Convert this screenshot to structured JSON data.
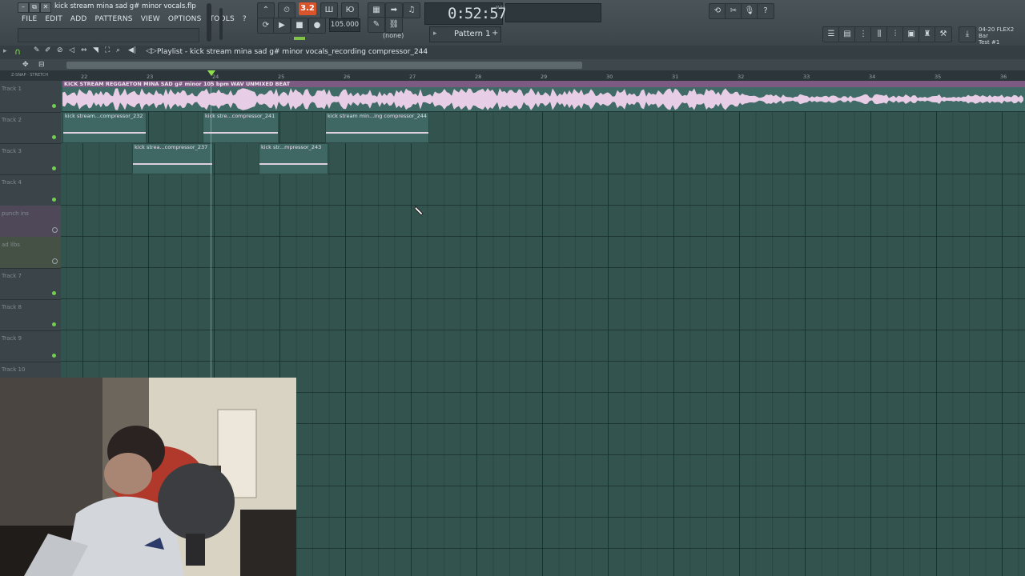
{
  "window": {
    "file_title": "kick stream mina sad g# minor vocals.flp",
    "minimize": "–",
    "restore": "⧉",
    "close": "✕"
  },
  "menu": [
    "FILE",
    "EDIT",
    "ADD",
    "PATTERNS",
    "VIEW",
    "OPTIONS",
    "TOOLS",
    "?"
  ],
  "transport": {
    "record_count": "3.2",
    "tempo": "105.000",
    "time": "0:52:57",
    "time_unit": "M:S:CS",
    "none_label": "(none)",
    "pattern": "Pattern 1",
    "right_label_line1": "04-20 FLEX2 Bar",
    "right_label_line2": "Test #1"
  },
  "playlist": {
    "title": "Playlist - kick stream mina sad g# minor vocals_recording compressor_244",
    "bar_numbers": [
      "22",
      "23",
      "24",
      "25",
      "26",
      "27",
      "28",
      "29",
      "30",
      "31",
      "32",
      "33",
      "34",
      "35",
      "36"
    ],
    "tracks": [
      {
        "name": "Track 1"
      },
      {
        "name": "Track 2"
      },
      {
        "name": "Track 3"
      },
      {
        "name": "Track 4"
      },
      {
        "name": "punch ins"
      },
      {
        "name": "ad libs"
      },
      {
        "name": "Track 7"
      },
      {
        "name": "Track 8"
      },
      {
        "name": "Track 9"
      },
      {
        "name": "Track 10"
      }
    ],
    "clips": {
      "main": "KICK STREAM REGGAETON MINA SAD g# minor 105 bpm WAV UNMIXED BEAT",
      "c232": "kick stream...compressor_232",
      "c241": "kick stre...compressor_241",
      "c244": "kick stream min...ing compressor_244",
      "c237": "kick strea...compressor_237",
      "c243": "kick str...mpressor_243"
    }
  },
  "colors": {
    "accent_record": "#d9532b",
    "grid_bg": "#33534f",
    "audio_clip_header": "#7c5a82",
    "track_indicator": "#6fd24a"
  }
}
